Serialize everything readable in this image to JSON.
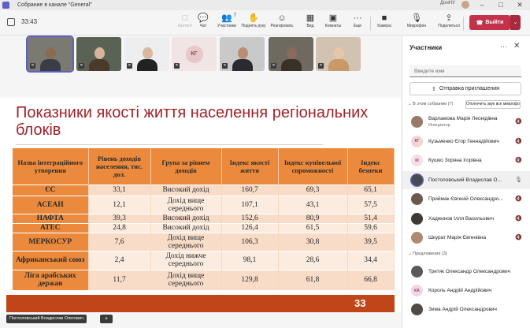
{
  "window": {
    "title": "Собрание в канале \"General\"",
    "user": "ДонНУ"
  },
  "toolbar": {
    "timer": "33:43",
    "tools": [
      {
        "label": "Контент",
        "icon": "□",
        "disabled": true
      },
      {
        "label": "Чат",
        "icon": "💬",
        "disabled": false
      },
      {
        "label": "Участники",
        "icon": "👥",
        "badge": "7",
        "disabled": false
      },
      {
        "label": "Поднять руку",
        "icon": "✋",
        "disabled": false
      },
      {
        "label": "Реагировать",
        "icon": "☺",
        "disabled": false
      },
      {
        "label": "Вид",
        "icon": "▦",
        "disabled": false
      },
      {
        "label": "Комнаты",
        "icon": "▣",
        "disabled": false
      },
      {
        "label": "Еще",
        "icon": "···",
        "disabled": false
      },
      {
        "label": "Камера",
        "icon": "■",
        "disabled": false
      },
      {
        "label": "Микрофон",
        "icon": "🎙",
        "disabled": false
      },
      {
        "label": "Поделиться",
        "icon": "⇪",
        "disabled": false
      }
    ],
    "leave_label": "Выйти"
  },
  "video_tiles": [
    {
      "kind": "person",
      "head": "#8a6a52",
      "body": "#3c3c46",
      "bg": "#7a7a72",
      "active": true
    },
    {
      "kind": "person",
      "head": "#d7b49a",
      "body": "#4a3a2a",
      "bg": "#5a6256",
      "active": false
    },
    {
      "kind": "person",
      "head": "#d9b8a0",
      "body": "#222222",
      "bg": "#eeeeee",
      "active": false
    },
    {
      "kind": "initials",
      "initials": "КГ"
    },
    {
      "kind": "person",
      "head": "#b98e70",
      "body": "#2a2a30",
      "bg": "#c9c9c9",
      "active": false
    },
    {
      "kind": "person",
      "head": "#8a6a5a",
      "body": "#3a3028",
      "bg": "#6f6a60",
      "active": false
    },
    {
      "kind": "person",
      "head": "#e6c8a8",
      "body": "#c89a6a",
      "bg": "#d2c2b2",
      "active": false
    }
  ],
  "slide": {
    "title": "Показники якості життя населення регіональних блоків",
    "columns": [
      "Назва інтеграційного утворення",
      "Рівень доходів населення, тис. дол.",
      "Група за рівнем доходів",
      "Індекс якості життя",
      "Індекс купівельної спроможності",
      "Індекс безпеки"
    ],
    "rows": [
      [
        "ЄС",
        "33,1",
        "Високий дохід",
        "160,7",
        "69,3",
        "65,1"
      ],
      [
        "АСЕАН",
        "12,1",
        "Дохід вище середнього",
        "107,1",
        "43,1",
        "57,5"
      ],
      [
        "НАФТА",
        "39,3",
        "Високий дохід",
        "152,6",
        "80,9",
        "51,4"
      ],
      [
        "АТЕС",
        "24,8",
        "Високий дохід",
        "126,4",
        "61,5",
        "59,6"
      ],
      [
        "МЕРКОСУР",
        "7,6",
        "Дохід вище середнього",
        "106,3",
        "30,8",
        "39,5"
      ],
      [
        "Африканський союз",
        "2,4",
        "Дохід нижче середнього",
        "98,1",
        "28,6",
        "34,4"
      ],
      [
        "Ліга арабських держав",
        "11,7",
        "Дохід вище середнього",
        "129,8",
        "61,8",
        "66,8"
      ]
    ],
    "page_number": "33"
  },
  "presenter_name": "Постоловський Владислав Олегович",
  "panel": {
    "title": "Участники",
    "search_placeholder": "Введите имя",
    "invite_label": "Отправка приглашения",
    "in_meeting_label": "В этом собрании (7)",
    "mute_all_label": "Отключить звук все микрофоны",
    "suggestions_label": "Предложения (3)",
    "participants": [
      {
        "name": "Варламова Марія Леонідівна",
        "role": "Инициатор",
        "avatar_type": "photo",
        "color": "#9a7a66",
        "initials": ""
      },
      {
        "name": "Кузьменко Єгор Геннадійович",
        "role": "",
        "avatar_type": "initials",
        "color": "#f2d6d6",
        "initials": "КГ"
      },
      {
        "name": "Кушко Зоряна Ігорівна",
        "role": "",
        "avatar_type": "initials",
        "color": "#f6dde6",
        "initials": "КІ"
      },
      {
        "name": "Постоловський Владислав О...",
        "role": "",
        "avatar_type": "photo",
        "color": "#4a4a52",
        "initials": "",
        "active": true
      },
      {
        "name": "Приймак Євгеній Олександро...",
        "role": "",
        "avatar_type": "photo",
        "color": "#6a5a4e",
        "initials": ""
      },
      {
        "name": "Хаджинов Ілля Васильович",
        "role": "",
        "avatar_type": "photo",
        "color": "#3e3a36",
        "initials": ""
      },
      {
        "name": "Шкурат Марія Євгенівна",
        "role": "",
        "avatar_type": "photo",
        "color": "#b08a6e",
        "initials": ""
      }
    ],
    "suggestions": [
      {
        "name": "Третяк Олександр Олександрович",
        "avatar_type": "photo",
        "color": "#5a5a5a",
        "initials": ""
      },
      {
        "name": "Король Андрій Андрійович",
        "avatar_type": "initials",
        "color": "#f2d6e6",
        "initials": "КА"
      },
      {
        "name": "Зима Андрій Олександрович",
        "avatar_type": "photo",
        "color": "#4e4a46",
        "initials": ""
      }
    ]
  }
}
